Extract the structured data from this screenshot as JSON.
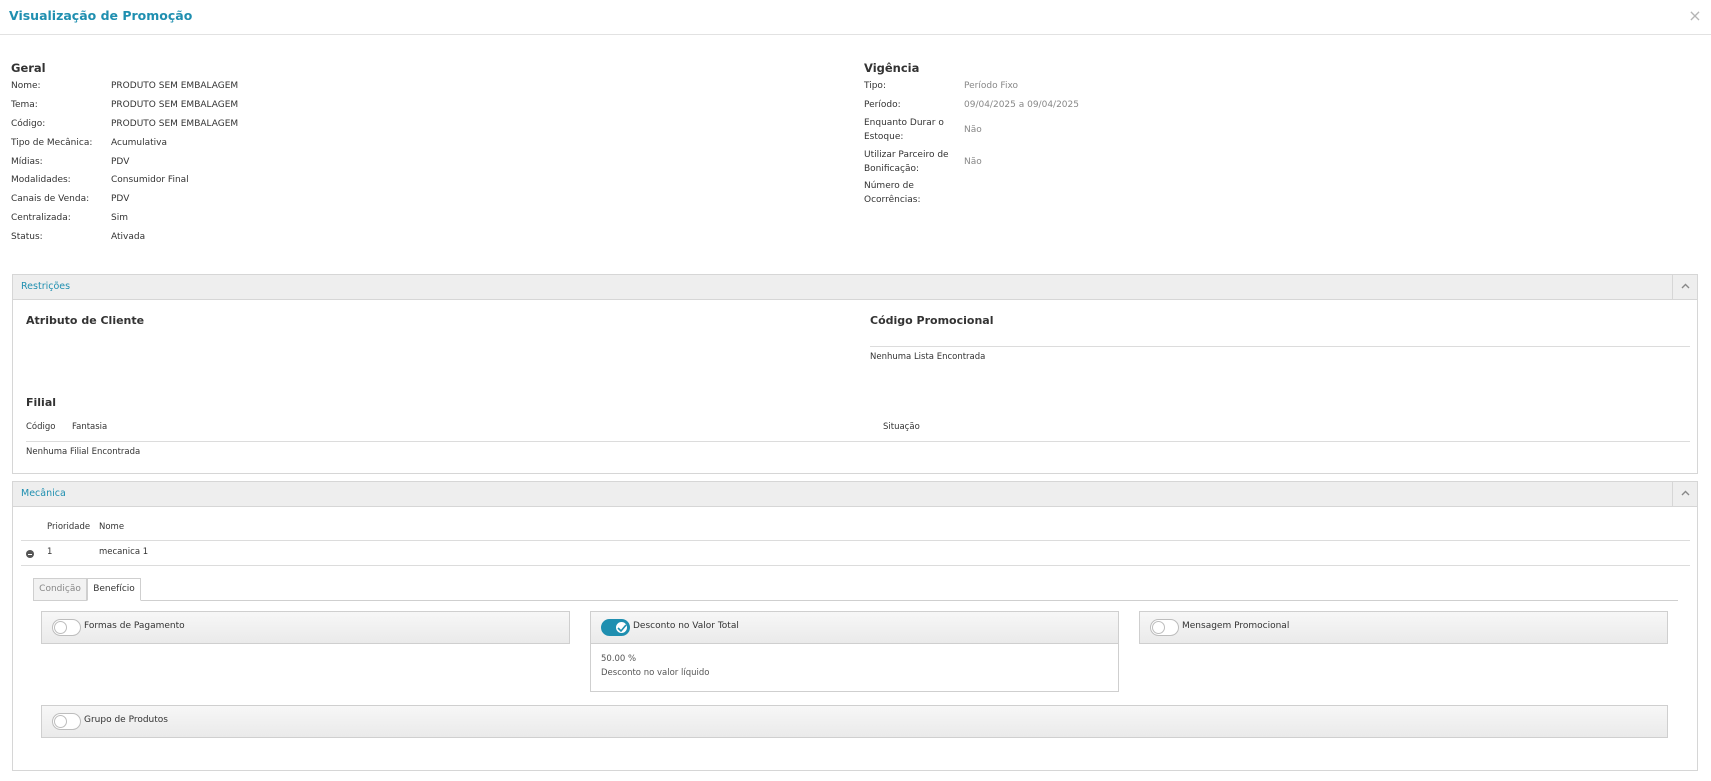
{
  "modal": {
    "title": "Visualização de Promoção",
    "close": "×"
  },
  "geral": {
    "title": "Geral",
    "fields": [
      {
        "label": "Nome:",
        "value": "PRODUTO SEM EMBALAGEM"
      },
      {
        "label": "Tema:",
        "value": "PRODUTO SEM EMBALAGEM"
      },
      {
        "label": "Código:",
        "value": "PRODUTO SEM EMBALAGEM"
      },
      {
        "label": "Tipo de Mecânica:",
        "value": "Acumulativa"
      },
      {
        "label": "Mídias:",
        "value": "PDV"
      },
      {
        "label": "Modalidades:",
        "value": "Consumidor Final"
      },
      {
        "label": "Canais de Venda:",
        "value": "PDV"
      },
      {
        "label": "Centralizada:",
        "value": "Sim"
      },
      {
        "label": "Status:",
        "value": "Ativada"
      }
    ]
  },
  "vigencia": {
    "title": "Vigência",
    "tipo_label": "Tipo:",
    "tipo_value": "Período Fixo",
    "periodo_label": "Período:",
    "periodo_value": "09/04/2025 a 09/04/2025",
    "estoque_label_1": "Enquanto Durar o",
    "estoque_label_2": "Estoque:",
    "estoque_value": "Não",
    "parceiro_label_1": "Utilizar Parceiro de",
    "parceiro_label_2": "Bonificação:",
    "parceiro_value": "Não",
    "ocorrencias_label_1": "Número de",
    "ocorrencias_label_2": "Ocorrências:"
  },
  "restricoes": {
    "title": "Restrições",
    "atributo_title": "Atributo de Cliente",
    "codigo_title": "Código Promocional",
    "codigo_empty": "Nenhuma Lista Encontrada",
    "filial_title": "Filial",
    "filial_columns": [
      "Código",
      "Fantasia",
      "Situação"
    ],
    "filial_empty": "Nenhuma Filial Encontrada"
  },
  "mecanica": {
    "title": "Mecânica",
    "columns": [
      "Prioridade",
      "Nome"
    ],
    "row": {
      "prioridade": "1",
      "nome": "mecanica 1"
    },
    "tabs": [
      "Condição",
      "Benefício"
    ],
    "cards": {
      "formas": "Formas de Pagamento",
      "desconto": "Desconto no Valor Total",
      "mensagem": "Mensagem Promocional",
      "grupo": "Grupo de Produtos"
    },
    "desconto_detail": {
      "value": "50.00 %",
      "desc": "Desconto no valor líquido"
    }
  },
  "colors": {
    "accent": "#1f8fb0",
    "toggle_on": "#1f8fb0"
  }
}
